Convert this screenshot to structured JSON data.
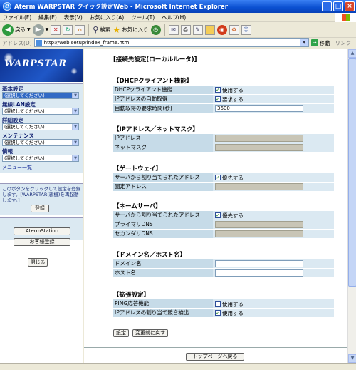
{
  "window": {
    "title": "Aterm WARPSTAR クイック設定Web - Microsoft Internet Explorer"
  },
  "menu": [
    "ファイル(F)",
    "編集(E)",
    "表示(V)",
    "お気に入り(A)",
    "ツール(T)",
    "ヘルプ(H)"
  ],
  "toolbar": {
    "back": "戻る",
    "search": "検索",
    "favorites": "お気に入り"
  },
  "address": {
    "label": "アドレス(D)",
    "url": "http://web.setup/index_frame.html",
    "go": "移動",
    "links": "リンク"
  },
  "sidebar": {
    "logo": "WARPSTAR",
    "groups": [
      {
        "caption": "基本設定",
        "select": "(選択してください)"
      },
      {
        "caption": "無線LAN設定",
        "select": "(選択してください)"
      },
      {
        "caption": "詳細設定",
        "select": "(選択してください)"
      },
      {
        "caption": "メンテナンス",
        "select": "(選択してください)"
      },
      {
        "caption": "情報",
        "select": "(選択してください)"
      }
    ],
    "menu_list": "メニュー一覧",
    "note": "このボタンをクリックして設定を登録します。[WARPSTAR(親機)を再起動します。]",
    "register": "登録",
    "aterm_station": "AtermStation",
    "customer_register": "お客様登録",
    "close": "閉じる"
  },
  "content": {
    "title": "[接続先設定(ローカルルータ)]",
    "dhcp": {
      "head": "【DHCPクライアント機能】",
      "rows": [
        {
          "label": "DHCPクライアント機能",
          "value": "使用する"
        },
        {
          "label": "IPアドレスの自動取得",
          "value": "要求する"
        },
        {
          "label": "自動取得の要求時間(秒)",
          "value": "3600"
        }
      ]
    },
    "ip": {
      "head": "【IPアドレス／ネットマスク】",
      "rows": [
        {
          "label": "IPアドレス"
        },
        {
          "label": "ネットマスク"
        }
      ]
    },
    "gateway": {
      "head": "【ゲートウェイ】",
      "rows": [
        {
          "label": "サーバから割り当てられたアドレス",
          "value": "優先する"
        },
        {
          "label": "固定アドレス"
        }
      ]
    },
    "dns": {
      "head": "【ネームサーバ】",
      "rows": [
        {
          "label": "サーバから割り当てられたアドレス",
          "value": "優先する"
        },
        {
          "label": "プライマリDNS"
        },
        {
          "label": "セカンダリDNS"
        }
      ]
    },
    "domain": {
      "head": "【ドメイン名／ホスト名】",
      "rows": [
        {
          "label": "ドメイン名"
        },
        {
          "label": "ホスト名"
        }
      ]
    },
    "ext": {
      "head": "【拡張設定】",
      "rows": [
        {
          "label": "PING応答機能",
          "value": "使用する"
        },
        {
          "label": "IPアドレスの割り当て競合検出",
          "value": "使用する"
        }
      ]
    },
    "set_button": "設定",
    "reset_button": "変更前に戻す",
    "top_button": "トップページへ戻る"
  }
}
